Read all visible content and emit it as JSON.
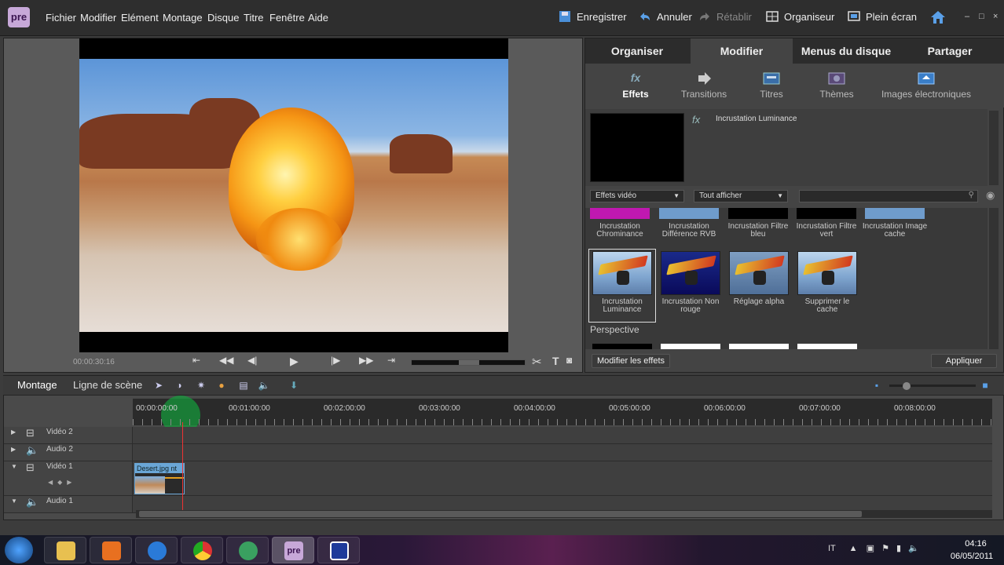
{
  "app": {
    "logo": "pre"
  },
  "menu": [
    "Fichier",
    "Modifier",
    "Elément",
    "Montage",
    "Disque",
    "Titre",
    "Fenêtre",
    "Aide"
  ],
  "toolbar": {
    "save": "Enregistrer",
    "undo": "Annuler",
    "redo": "Rétablir",
    "organizer": "Organiseur",
    "fullscreen": "Plein écran",
    "home_icon": "home-icon"
  },
  "window_controls": [
    "–",
    "□",
    "×"
  ],
  "monitor": {
    "timecode": "00:00:30:16"
  },
  "panel": {
    "tabs": [
      "Organiser",
      "Modifier",
      "Menus du disque",
      "Partager"
    ],
    "active_tab": "Modifier",
    "subtabs": [
      "Effets",
      "Transitions",
      "Titres",
      "Thèmes",
      "Images électroniques"
    ],
    "active_subtab": "Effets",
    "preview_title": "Incrustation Luminance",
    "dropdown_category": "Effets vidéo",
    "dropdown_filter": "Tout afficher",
    "search_value": "",
    "effects_row1": [
      "Incrustation Chrominance",
      "Incrustation Différence RVB",
      "Incrustation Filtre bleu",
      "Incrustation Filtre vert",
      "Incrustation Image cache"
    ],
    "effects_row2": [
      "Incrustation Luminance",
      "Incrustation Non rouge",
      "Réglage alpha",
      "Supprimer le cache"
    ],
    "section_perspective": "Perspective",
    "btn_modify_effects": "Modifier les effets",
    "btn_apply": "Appliquer"
  },
  "timeline": {
    "tab_montage": "Montage",
    "tab_scene": "Ligne de scène",
    "ruler": [
      "00:00:00:00",
      "00:01:00:00",
      "00:02:00:00",
      "00:03:00:00",
      "00:04:00:00",
      "00:05:00:00",
      "00:06:00:00",
      "00:07:00:00",
      "00:08:00:00"
    ],
    "tracks": [
      "Vidéo 2",
      "Audio 2",
      "Vidéo 1",
      "Audio 1"
    ],
    "clip_label": "Desert.jpg  nt"
  },
  "taskbar": {
    "lang": "IT",
    "time": "04:16",
    "date": "06/05/2011",
    "pre_label": "pre"
  }
}
